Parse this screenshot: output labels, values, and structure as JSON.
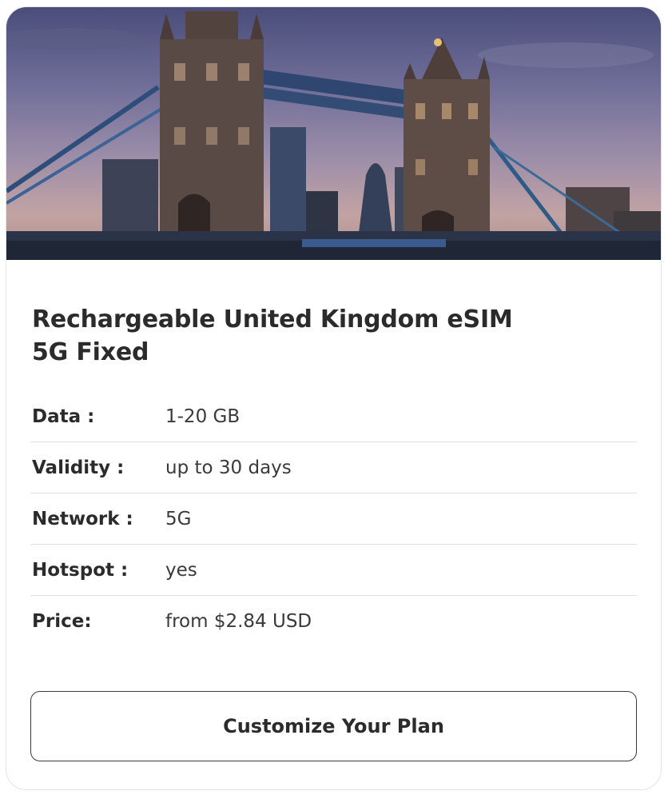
{
  "product": {
    "image": {
      "icon": "tower-bridge-london-photo"
    },
    "title_line1": "Rechargeable United Kingdom eSIM",
    "title_line2": "5G Fixed"
  },
  "specs": [
    {
      "label": "Data :",
      "value": "1-20 GB"
    },
    {
      "label": "Validity :",
      "value": "up to 30 days"
    },
    {
      "label": "Network :",
      "value": "5G"
    },
    {
      "label": "Hotspot :",
      "value": "yes"
    },
    {
      "label": "Price:",
      "value": "from $2.84 USD"
    }
  ],
  "cta": {
    "label": "Customize Your Plan"
  }
}
